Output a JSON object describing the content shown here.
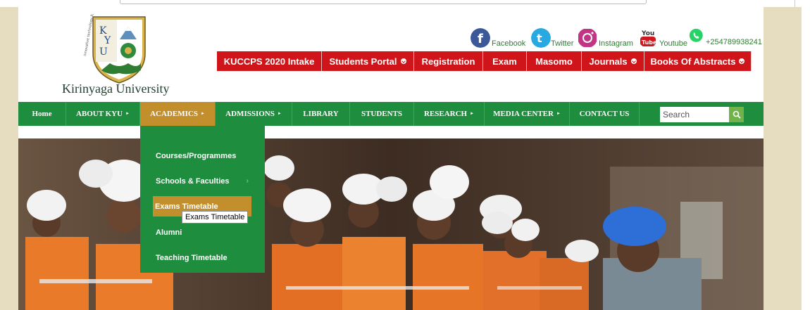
{
  "brand": {
    "university_name": "Kirinyaga University"
  },
  "socials": [
    {
      "name": "facebook-icon",
      "label": "Facebook",
      "color": "#3b5998"
    },
    {
      "name": "twitter-icon",
      "label": "Twitter",
      "color": "#29a9e1"
    },
    {
      "name": "instagram-icon",
      "label": "Instagram",
      "color": "#c13584"
    },
    {
      "name": "youtube-icon",
      "label": "Youtube",
      "color": "#cc181e"
    },
    {
      "name": "whatsapp-icon",
      "label": "+254789938241",
      "color": "#25d366"
    }
  ],
  "red_menu": [
    {
      "label": "KUCCPS 2020 Intake",
      "dropdown": false
    },
    {
      "label": "Students Portal",
      "dropdown": true
    },
    {
      "label": "Registration",
      "dropdown": false
    },
    {
      "label": "Exam",
      "dropdown": false
    },
    {
      "label": "Masomo",
      "dropdown": false
    },
    {
      "label": "Journals",
      "dropdown": true
    },
    {
      "label": "Books Of Abstracts",
      "dropdown": true
    }
  ],
  "green_nav": [
    {
      "label": "Home",
      "dropdown": false
    },
    {
      "label": "ABOUT KYU",
      "dropdown": true
    },
    {
      "label": "ACADEMICS",
      "dropdown": true,
      "active": true
    },
    {
      "label": "ADMISSIONS",
      "dropdown": true
    },
    {
      "label": "LIBRARY",
      "dropdown": false
    },
    {
      "label": "STUDENTS",
      "dropdown": false
    },
    {
      "label": "RESEARCH",
      "dropdown": true
    },
    {
      "label": "MEDIA CENTER",
      "dropdown": true
    },
    {
      "label": "CONTACT US",
      "dropdown": false
    }
  ],
  "search": {
    "placeholder": "Search"
  },
  "academics_menu": [
    {
      "label": "Courses/Programmes"
    },
    {
      "label": "Schools & Faculties",
      "submenu": true
    },
    {
      "label": "Exams Timetable",
      "highlighted": true
    },
    {
      "label": "Alumni"
    },
    {
      "label": "Teaching Timetable"
    }
  ],
  "tooltip": {
    "text": "Exams Timetable"
  },
  "colors": {
    "green": "#1e8e3e",
    "gold": "#c28f2c",
    "red": "#d0151a",
    "beige": "#e6dcc0"
  }
}
